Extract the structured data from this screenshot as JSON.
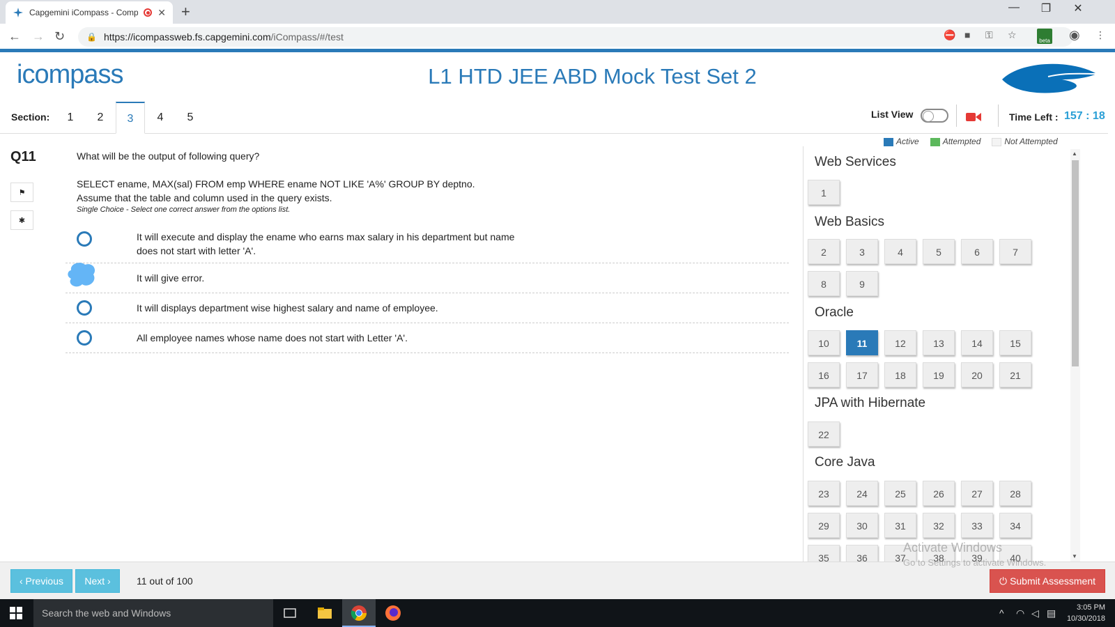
{
  "browser": {
    "tab_title": "Capgemini iCompass - Comp",
    "url_host": "https://icompassweb.fs.capgemini.com",
    "url_path": "/iCompass/#/test",
    "beta_badge": "beta"
  },
  "header": {
    "logo": "icompass",
    "title": "L1 HTD JEE ABD Mock Test Set 2"
  },
  "sections": {
    "label": "Section:",
    "tabs": [
      "1",
      "2",
      "3",
      "4",
      "5"
    ],
    "active": "3"
  },
  "controls": {
    "list_view_label": "List View",
    "time_left_label": "Time Left :",
    "time_left_value": "157 : 18"
  },
  "legend": {
    "active": "Active",
    "attempted": "Attempted",
    "not_attempted": "Not Attempted",
    "active_color": "#2a7ab8",
    "attempted_color": "#5cb85c"
  },
  "question": {
    "number": "Q11",
    "line1": "What will be the output of following query?",
    "line2": "SELECT ename, MAX(sal) FROM emp WHERE ename NOT LIKE 'A%' GROUP BY deptno.",
    "line3": "Assume that the table and column used in the query exists.",
    "hint": "Single Choice - Select one correct answer from the options list.",
    "options": [
      "It will execute and display the ename who earns max salary in his department but name does not start with letter 'A'.",
      "It will give error.",
      "It will displays department wise highest salary and name of employee.",
      "All employee names whose name does not start with Letter 'A'."
    ]
  },
  "panel": {
    "groups": [
      {
        "title": "Web Services",
        "items": [
          "1"
        ]
      },
      {
        "title": "Web Basics",
        "items": [
          "2",
          "3",
          "4",
          "5",
          "6",
          "7",
          "8",
          "9"
        ]
      },
      {
        "title": "Oracle",
        "items": [
          "10",
          "11",
          "12",
          "13",
          "14",
          "15",
          "16",
          "17",
          "18",
          "19",
          "20",
          "21"
        ]
      },
      {
        "title": "JPA with Hibernate",
        "items": [
          "22"
        ]
      },
      {
        "title": "Core Java",
        "items": [
          "23",
          "24",
          "25",
          "26",
          "27",
          "28",
          "29",
          "30",
          "31",
          "32",
          "33",
          "34",
          "35",
          "36",
          "37",
          "38",
          "39",
          "40"
        ]
      }
    ],
    "active_item": "11"
  },
  "footer": {
    "previous": "‹ Previous",
    "next": "Next ›",
    "counter": "11 out of 100",
    "submit": "Submit Assessment"
  },
  "watermark": {
    "line1": "Activate Windows",
    "line2": "Go to Settings to activate Windows."
  },
  "taskbar": {
    "search": "Search the web and Windows",
    "time": "3:05 PM",
    "date": "10/30/2018"
  }
}
